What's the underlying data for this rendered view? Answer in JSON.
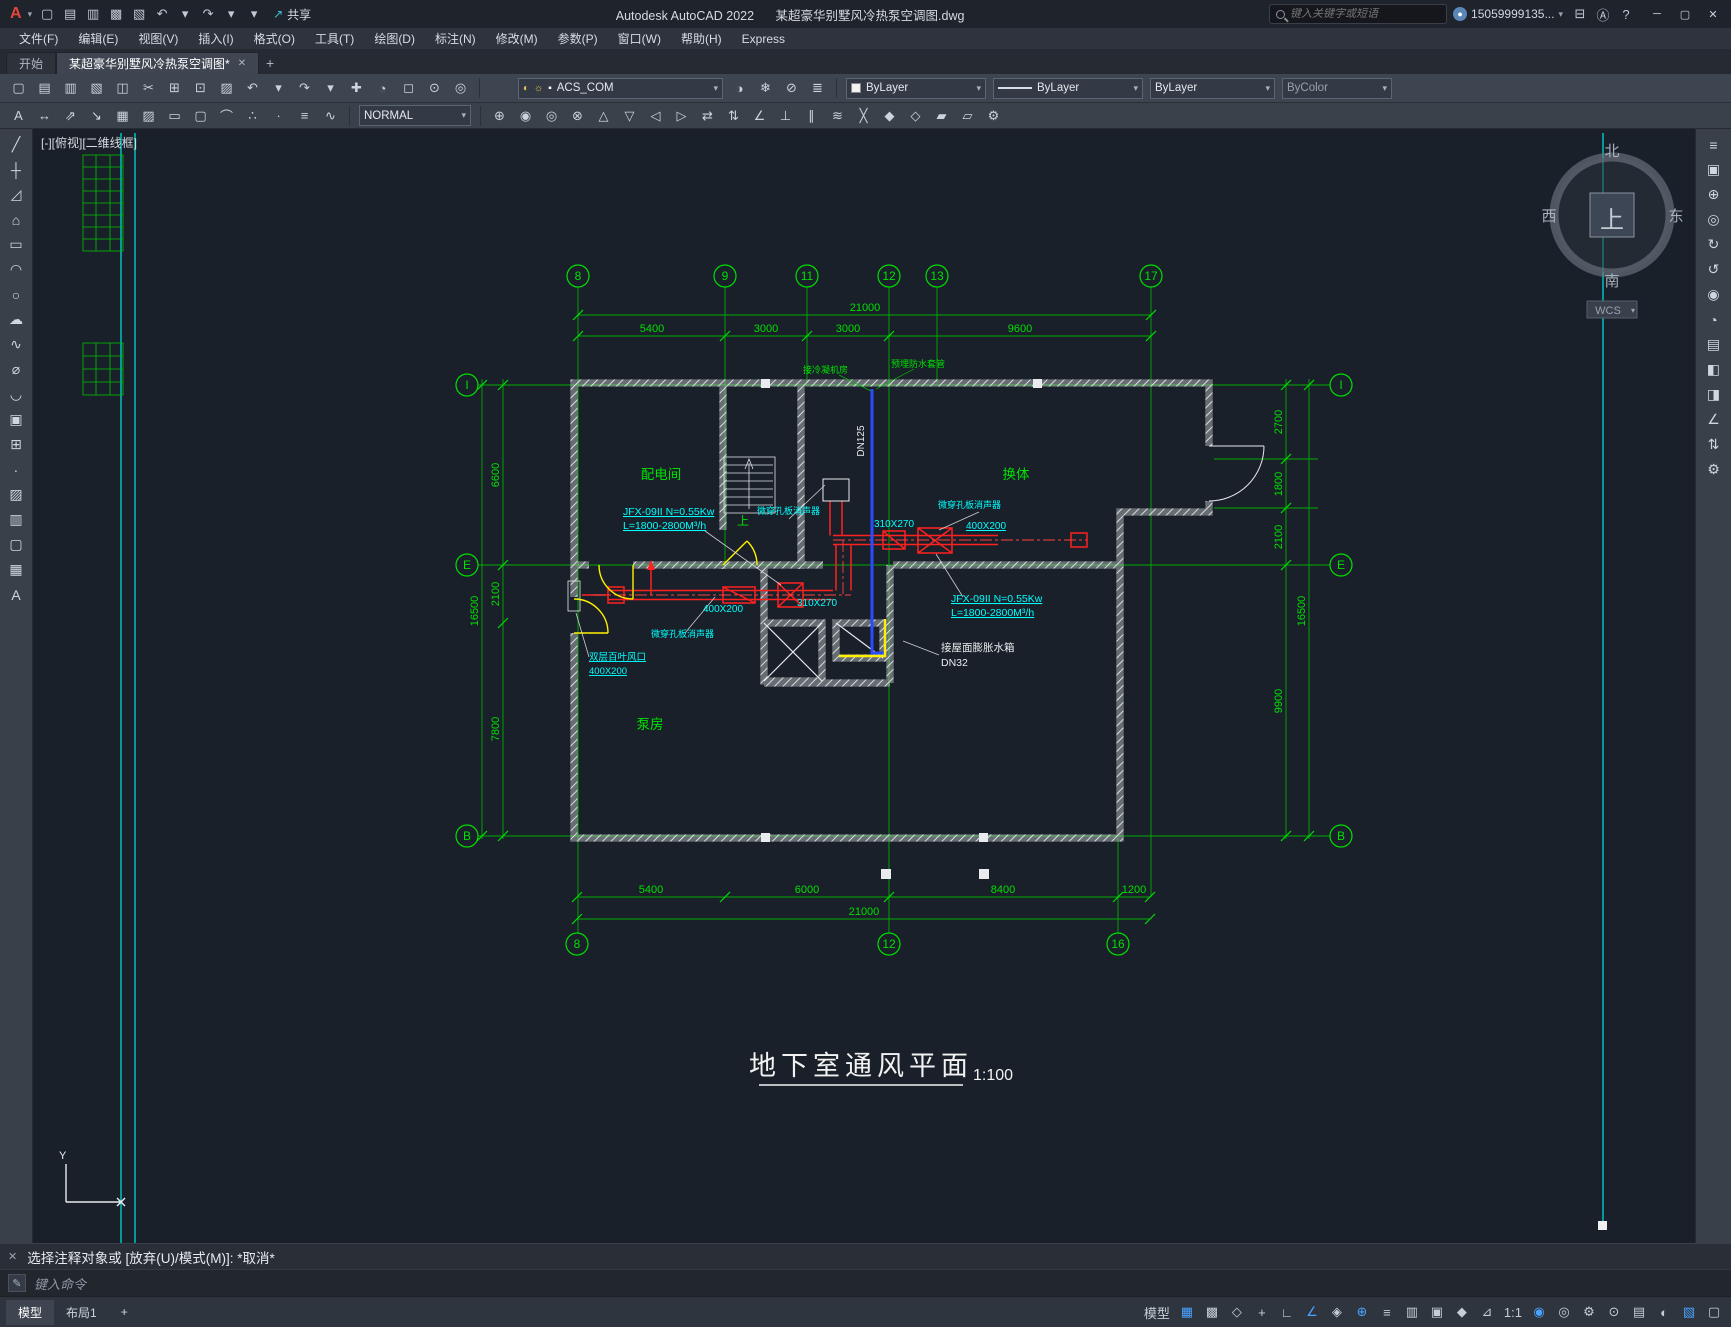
{
  "titlebar": {
    "logo": "A",
    "logo_caret": "▾",
    "qat": [
      {
        "n": "new-file-button",
        "g": "▢"
      },
      {
        "n": "open-file-button",
        "g": "▤"
      },
      {
        "n": "save-button",
        "g": "▥"
      },
      {
        "n": "save-as-button",
        "g": "▩"
      },
      {
        "n": "plot-button",
        "g": "▧"
      },
      {
        "n": "undo-button",
        "g": "↶"
      },
      {
        "n": "undo-caret",
        "g": "▾"
      },
      {
        "n": "redo-button",
        "g": "↷"
      },
      {
        "n": "redo-caret",
        "g": "▾"
      },
      {
        "n": "qat-customize-button",
        "g": "▾"
      }
    ],
    "share_label": "共享",
    "share_icon": "↗",
    "app_name": "Autodesk AutoCAD 2022",
    "doc_name": "某超豪华别墅风冷热泵空调图.dwg",
    "search_placeholder": "键入关键字或短语",
    "user_id": "15059999135...",
    "user_caret": "▾",
    "right_icons": [
      {
        "n": "cart-icon",
        "g": "⊟"
      },
      {
        "n": "a360-icon",
        "g": "Ⓐ"
      },
      {
        "n": "help-icon",
        "g": "?"
      }
    ],
    "win_min": "─",
    "win_max": "▢",
    "win_close": "✕"
  },
  "menubar": {
    "items": [
      "文件(F)",
      "编辑(E)",
      "视图(V)",
      "插入(I)",
      "格式(O)",
      "工具(T)",
      "绘图(D)",
      "标注(N)",
      "修改(M)",
      "参数(P)",
      "窗口(W)",
      "帮助(H)",
      "Express"
    ]
  },
  "tabs": {
    "home": "开始",
    "doc": "某超豪华别墅风冷热泵空调图*",
    "close": "✕",
    "add": "+"
  },
  "toolbar1": {
    "icons_left": [
      {
        "n": "new",
        "g": "▢"
      },
      {
        "n": "open",
        "g": "▤"
      },
      {
        "n": "save",
        "g": "▥"
      },
      {
        "n": "plot",
        "g": "▧"
      },
      {
        "n": "preview",
        "g": "◫"
      },
      {
        "n": "cut",
        "g": "✂"
      },
      {
        "n": "copy-clip",
        "g": "⊞"
      },
      {
        "n": "paste",
        "g": "⊡"
      },
      {
        "n": "match-properties",
        "g": "▨"
      },
      {
        "n": "undo",
        "g": "↶"
      },
      {
        "n": "undo-caret",
        "g": "▾"
      },
      {
        "n": "redo",
        "g": "↷"
      },
      {
        "n": "redo-caret",
        "g": "▾"
      },
      {
        "n": "pan",
        "g": "✚"
      },
      {
        "n": "zoom-realtime",
        "g": "◔"
      },
      {
        "n": "zoom-window",
        "g": "◻"
      },
      {
        "n": "zoom-extents",
        "g": "⊙"
      },
      {
        "n": "orbit",
        "g": "◎"
      }
    ],
    "layer_icons": [
      "◐",
      "☼",
      "▪"
    ],
    "layer_value": "ACS_COM",
    "icons_mid": [
      {
        "n": "layer-off",
        "g": "◑"
      },
      {
        "n": "layer-freeze",
        "g": "❄"
      },
      {
        "n": "layer-lock",
        "g": "⊘"
      },
      {
        "n": "layer-properties",
        "g": "≣"
      }
    ],
    "color_value": "ByLayer",
    "linetype_value": "ByLayer",
    "lineweight_value": "ByLayer",
    "plotstyle_value": "ByColor"
  },
  "toolbar2": {
    "icons_left": [
      {
        "n": "mtext",
        "g": "A"
      },
      {
        "n": "dim-linear",
        "g": "↔"
      },
      {
        "n": "dim-aligned",
        "g": "⇗"
      },
      {
        "n": "leader",
        "g": "↘"
      },
      {
        "n": "table",
        "g": "▦"
      },
      {
        "n": "hatch",
        "g": "▨"
      },
      {
        "n": "boundary",
        "g": "▭"
      },
      {
        "n": "region",
        "g": "▢"
      },
      {
        "n": "arc-tool",
        "g": "⌒"
      },
      {
        "n": "divide",
        "g": "∴"
      },
      {
        "n": "point",
        "g": "∙"
      },
      {
        "n": "multiline",
        "g": "≡"
      },
      {
        "n": "spline",
        "g": "∿"
      }
    ],
    "text_style_value": "NORMAL",
    "icons_right": [
      {
        "n": "move",
        "g": "⊕"
      },
      {
        "n": "copy",
        "g": "◉"
      },
      {
        "n": "stretch",
        "g": "◎"
      },
      {
        "n": "rotate",
        "g": "⊗"
      },
      {
        "n": "mirror",
        "g": "△"
      },
      {
        "n": "array",
        "g": "▽"
      },
      {
        "n": "offset",
        "g": "◁"
      },
      {
        "n": "trim",
        "g": "▷"
      },
      {
        "n": "extend",
        "g": "⇄"
      },
      {
        "n": "fillet",
        "g": "⇅"
      },
      {
        "n": "chamfer",
        "g": "∠"
      },
      {
        "n": "scale",
        "g": "⊥"
      },
      {
        "n": "break",
        "g": "∥"
      },
      {
        "n": "join",
        "g": "≋"
      },
      {
        "n": "explode",
        "g": "╳"
      },
      {
        "n": "erase",
        "g": "◆"
      },
      {
        "n": "properties",
        "g": "◇"
      },
      {
        "n": "group",
        "g": "▰"
      },
      {
        "n": "ungroup",
        "g": "▱"
      },
      {
        "n": "options",
        "g": "⚙"
      }
    ]
  },
  "left_palette": {
    "items": [
      {
        "n": "line-tool",
        "g": "╱"
      },
      {
        "n": "construction-line-tool",
        "g": "┼"
      },
      {
        "n": "polyline-tool",
        "g": "◿"
      },
      {
        "n": "polygon-tool",
        "g": "⌂"
      },
      {
        "n": "rectangle-tool",
        "g": "▭"
      },
      {
        "n": "arc-tool",
        "g": "◠"
      },
      {
        "n": "circle-tool",
        "g": "○"
      },
      {
        "n": "revision-cloud-tool",
        "g": "☁"
      },
      {
        "n": "spline-tool",
        "g": "∿"
      },
      {
        "n": "ellipse-tool",
        "g": "⌀"
      },
      {
        "n": "ellipse-arc-tool",
        "g": "◡"
      },
      {
        "n": "insert-block-tool",
        "g": "▣"
      },
      {
        "n": "make-block-tool",
        "g": "⊞"
      },
      {
        "n": "point-tool",
        "g": "∙"
      },
      {
        "n": "hatch-tool",
        "g": "▨"
      },
      {
        "n": "gradient-tool",
        "g": "▥"
      },
      {
        "n": "region-tool",
        "g": "▢"
      },
      {
        "n": "table-tool",
        "g": "▦"
      },
      {
        "n": "text-tool",
        "g": "A"
      }
    ]
  },
  "right_palette": {
    "items": [
      {
        "n": "nav-menu",
        "g": "≡"
      },
      {
        "n": "viewcube-tool",
        "g": "▣"
      },
      {
        "n": "pan-tool",
        "g": "⊕"
      },
      {
        "n": "zoom-tool",
        "g": "◎"
      },
      {
        "n": "orbit-tool",
        "g": "↻"
      },
      {
        "n": "rewind-tool",
        "g": "↺"
      },
      {
        "n": "steering-wheel",
        "g": "◉"
      },
      {
        "n": "showmotion",
        "g": "◔"
      },
      {
        "n": "layout-views",
        "g": "▤"
      },
      {
        "n": "half-left",
        "g": "◧"
      },
      {
        "n": "half-right",
        "g": "◨"
      },
      {
        "n": "angle-tool",
        "g": "∠"
      },
      {
        "n": "swap-view",
        "g": "⇅"
      },
      {
        "n": "settings",
        "g": "⚙"
      }
    ]
  },
  "canvas": {
    "viewport_label": "[-][俯视][二维线框]"
  },
  "compass": {
    "n": "北",
    "s": "南",
    "e": "东",
    "w": "西",
    "center": "上",
    "wcs": "WCS"
  },
  "drawing": {
    "axes": {
      "top": [
        "8",
        "9",
        "11",
        "12",
        "13",
        "17"
      ],
      "bottom": [
        "8",
        "12",
        "16"
      ],
      "left": [
        "I",
        "E",
        "B"
      ],
      "right": [
        "I",
        "E",
        "B"
      ]
    },
    "dims": {
      "top_total": "21000",
      "top": [
        "5400",
        "3000",
        "3000",
        "9600"
      ],
      "bottom": [
        "5400",
        "6000",
        "8400",
        "1200"
      ],
      "bottom_total": "21000",
      "left": [
        "6600",
        "2100",
        "7800"
      ],
      "left_total": "16500",
      "right": [
        "2700",
        "1800",
        "2100",
        "9900"
      ],
      "right_total": "16500"
    },
    "rooms": {
      "power": "配电间",
      "right": "换体",
      "pump": "泵房",
      "up": "上"
    },
    "labels": {
      "cond_room": "接冷凝机房",
      "sleeve": "预埋防水套管",
      "dn125": "DN125",
      "fan_l1": "JFX-09II N=0.55Kw",
      "fan_l2": "L=1800-2800M³/h",
      "silencer": "微穿孔板消声器",
      "duct_310": "310X270",
      "duct_400": "400X200",
      "louver1": "双层百叶风口",
      "louver2": "400X200",
      "tank1": "接屋面膨胀水箱",
      "tank2": "DN32",
      "title": "地下室通风平面",
      "scale": "1:100"
    }
  },
  "command": {
    "close": "✕",
    "prompt": "选择注释对象或 [放弃(U)/模式(M)]: *取消*",
    "input_icon": "✎",
    "input_hint": "键入命令"
  },
  "statusbar": {
    "model_tab": "模型",
    "layout_tab": "布局1",
    "add_tab": "+",
    "right": [
      {
        "n": "model-space-button",
        "g": "模型"
      },
      {
        "n": "grid-toggle",
        "g": "▦",
        "a": true
      },
      {
        "n": "snap-toggle",
        "g": "▩"
      },
      {
        "n": "infer-constraints",
        "g": "◇"
      },
      {
        "n": "dynamic-input",
        "g": "+"
      },
      {
        "n": "ortho-toggle",
        "g": "∟"
      },
      {
        "n": "polar-toggle",
        "g": "∠",
        "a": true
      },
      {
        "n": "isodraft",
        "g": "◈"
      },
      {
        "n": "osnap-toggle",
        "g": "⊕",
        "a": true
      },
      {
        "n": "lineweight-toggle",
        "g": "≡"
      },
      {
        "n": "transparency-toggle",
        "g": "▥"
      },
      {
        "n": "selection-cycling",
        "g": "▣"
      },
      {
        "n": "3d-osnap",
        "g": "◆"
      },
      {
        "n": "dynamic-ucs",
        "g": "⊿"
      },
      {
        "n": "annotation-scale",
        "g": "1:1"
      },
      {
        "n": "annotation-visibility",
        "g": "◉",
        "a": true
      },
      {
        "n": "autoscale",
        "g": "◎"
      },
      {
        "n": "workspace-switch",
        "g": "⚙"
      },
      {
        "n": "annotation-monitor",
        "g": "⊙"
      },
      {
        "n": "quick-properties",
        "g": "▤"
      },
      {
        "n": "isolate-objects",
        "g": "◐"
      },
      {
        "n": "graphics-performance",
        "g": "▧",
        "a": true
      },
      {
        "n": "clean-screen",
        "g": "▢"
      }
    ]
  }
}
